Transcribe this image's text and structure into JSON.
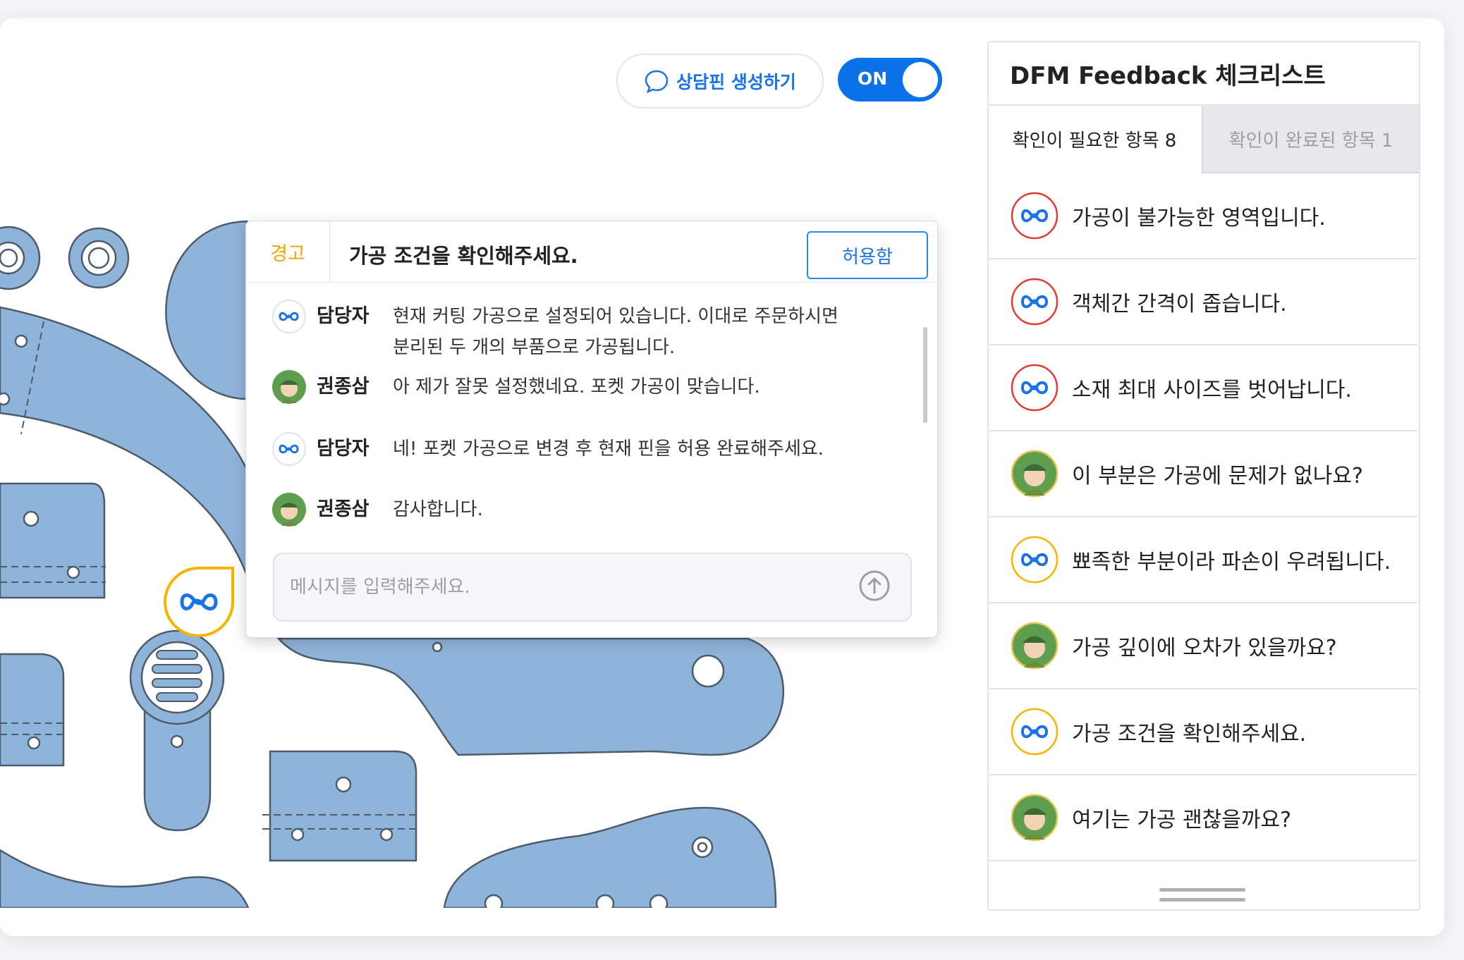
{
  "toolbar": {
    "pin_button_label": "상담핀 생성하기",
    "toggle_label": "ON"
  },
  "popup": {
    "tag": "경고",
    "title": "가공 조건을 확인해주세요.",
    "allow_label": "허용함",
    "messages": [
      {
        "author": "담당자",
        "text": "현재 커팅 가공으로 설정되어 있습니다. 이대로 주문하시면\n분리된 두 개의 부품으로 가공됩니다."
      },
      {
        "author": "권종삼",
        "text": "아 제가 잘못 설정했네요. 포켓 가공이 맞습니다."
      },
      {
        "author": "담당자",
        "text": "네! 포켓 가공으로 변경 후 현재 핀을 허용 완료해주세요."
      },
      {
        "author": "권종삼",
        "text": "감사합니다."
      }
    ],
    "input_placeholder": "메시지를 입력해주세요."
  },
  "sidebar": {
    "title": "DFM Feedback 체크리스트",
    "tabs": [
      {
        "label": "확인이 필요한 항목 8"
      },
      {
        "label": "확인이 완료된 항목 1"
      }
    ],
    "items": [
      {
        "label": "가공이 불가능한 영역입니다.",
        "icon": "logo-red"
      },
      {
        "label": "객체간 간격이 좁습니다.",
        "icon": "logo-red"
      },
      {
        "label": "소재 최대 사이즈를 벗어납니다.",
        "icon": "logo-red"
      },
      {
        "label": "이 부분은 가공에 문제가 없나요?",
        "icon": "user-avatar"
      },
      {
        "label": "뾰족한 부분이라 파손이 우려됩니다.",
        "icon": "logo-yellow"
      },
      {
        "label": "가공 깊이에 오차가 있을까요?",
        "icon": "user-avatar"
      },
      {
        "label": "가공 조건을 확인해주세요.",
        "icon": "logo-yellow"
      },
      {
        "label": "여기는 가공 괜찮을까요?",
        "icon": "user-avatar"
      }
    ]
  },
  "colors": {
    "accent": "#0a72e8",
    "part_fill": "#8fb4d9",
    "part_stroke": "#4d5b6b",
    "warning": "#f0a500",
    "error": "#e53935"
  }
}
